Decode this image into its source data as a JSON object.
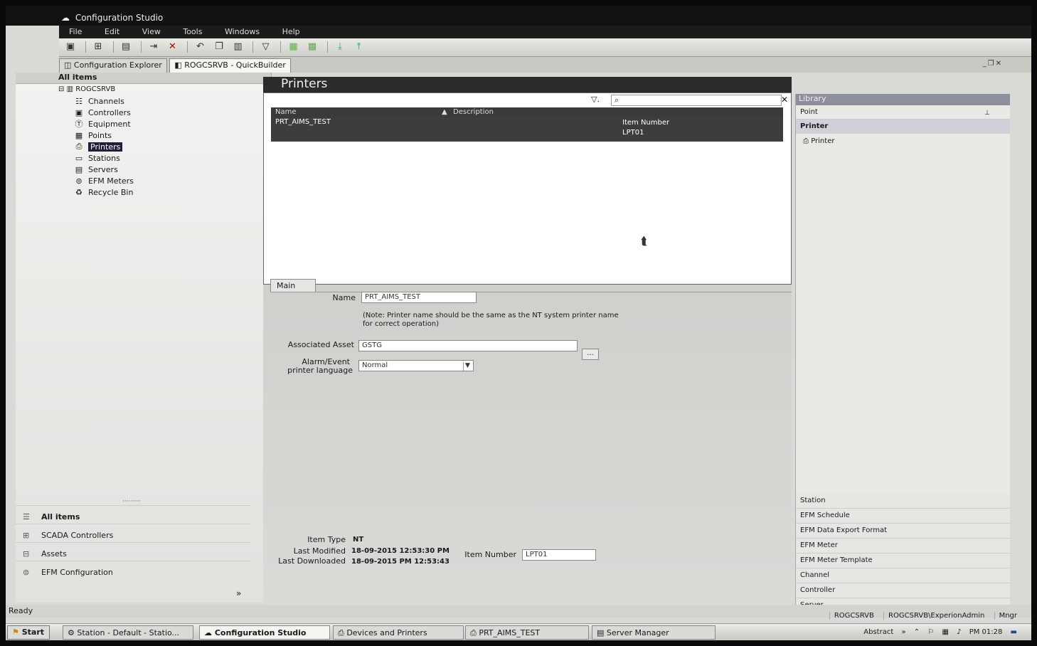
{
  "app": {
    "title": "Configuration Studio"
  },
  "menu": [
    "File",
    "Edit",
    "View",
    "Tools",
    "Windows",
    "Help"
  ],
  "toolbar_icons": [
    "explorer-icon",
    "network-icon",
    "save-icon",
    "download-icon",
    "delete-icon",
    "undo-icon",
    "copy-icon",
    "paste-icon",
    "filter-icon",
    "build-icon",
    "build-all-icon",
    "import-icon",
    "export-icon"
  ],
  "doc_tabs": [
    {
      "label": "Configuration Explorer"
    },
    {
      "label": "ROGCSRVB - QuickBuilder"
    }
  ],
  "left": {
    "header": "All items",
    "root": "ROGCSRVB",
    "tree": [
      {
        "label": "Channels",
        "icon": "channels-icon"
      },
      {
        "label": "Controllers",
        "icon": "controllers-icon"
      },
      {
        "label": "Equipment",
        "icon": "equipment-icon"
      },
      {
        "label": "Points",
        "icon": "points-icon"
      },
      {
        "label": "Printers",
        "icon": "printer-icon"
      },
      {
        "label": "Stations",
        "icon": "stations-icon"
      },
      {
        "label": "Servers",
        "icon": "servers-icon"
      },
      {
        "label": "EFM Meters",
        "icon": "meter-icon"
      },
      {
        "label": "Recycle Bin",
        "icon": "recycle-bin-icon"
      }
    ],
    "nav": [
      {
        "label": "All items"
      },
      {
        "label": "SCADA Controllers"
      },
      {
        "label": "Assets"
      },
      {
        "label": "EFM Configuration"
      }
    ]
  },
  "printers": {
    "title": "Printers",
    "columns": {
      "name": "Name",
      "description": "Description",
      "item_number": "Item Number"
    },
    "rows": [
      {
        "name": "PRT_AIMS_TEST",
        "description": "",
        "item_number": "LPT01"
      }
    ]
  },
  "detail": {
    "tab": "Main",
    "name_label": "Name",
    "name_value": "PRT_AIMS_TEST",
    "note": "(Note: Printer name should be the same as the NT system printer name for correct operation)",
    "asset_label": "Associated Asset",
    "asset_value": "GSTG",
    "ellipsis": "...",
    "alarm_label_1": "Alarm/Event",
    "alarm_label_2": "printer language",
    "alarm_value": "Normal",
    "item_type_label": "Item Type",
    "item_type_value": "NT",
    "last_modified_label": "Last Modified",
    "last_modified_value": "18-09-2015 12:53:30 PM",
    "last_downloaded_label": "Last Downloaded",
    "last_downloaded_value": "18-09-2015 PM 12:53:43",
    "item_number_label": "Item Number",
    "item_number_value": "LPT01"
  },
  "library": {
    "title": "Library",
    "top": [
      {
        "label": "Point"
      },
      {
        "label": "Printer"
      }
    ],
    "printer_item": "Printer",
    "bottom": [
      {
        "label": "Station"
      },
      {
        "label": "EFM Schedule"
      },
      {
        "label": "EFM Data Export Format"
      },
      {
        "label": "EFM Meter"
      },
      {
        "label": "EFM Meter Template"
      },
      {
        "label": "Channel"
      },
      {
        "label": "Controller"
      },
      {
        "label": "Server"
      }
    ]
  },
  "status": {
    "text": "Ready",
    "server": "ROGCSRVB",
    "user": "ROGCSRVB\\ExperionAdmin",
    "role": "Mngr"
  },
  "taskbar": {
    "start": "Start",
    "tasks": [
      {
        "label": "Station - Default - Statio..."
      },
      {
        "label": "Configuration Studio"
      },
      {
        "label": "Devices and Printers"
      },
      {
        "label": "PRT_AIMS_TEST"
      },
      {
        "label": "Server Manager"
      }
    ],
    "tray_text": "Abstract",
    "clock": "PM 01:28"
  }
}
